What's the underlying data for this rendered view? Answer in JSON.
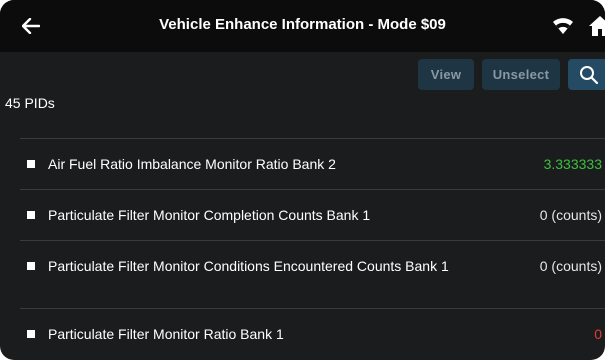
{
  "header": {
    "title": "Vehicle Enhance Information - Mode $09"
  },
  "toolbar": {
    "view_label": "View",
    "unselect_label": "Unselect"
  },
  "pid_count": "45 PIDs",
  "rows": [
    {
      "label": "Air Fuel Ratio Imbalance Monitor Ratio Bank 2",
      "value": "3.333333",
      "value_color": "#3fbf3f"
    },
    {
      "label": "Particulate Filter Monitor Completion Counts Bank 1",
      "value": "0 (counts)",
      "value_color": "#e6e6e6"
    },
    {
      "label": "Particulate Filter Monitor Conditions Encountered Counts Bank 1",
      "value": "0 (counts)",
      "value_color": "#e6e6e6"
    },
    {
      "label": "Particulate Filter Monitor Ratio Bank 1",
      "value": "0",
      "value_color": "#e03a3a"
    }
  ],
  "icons": {
    "back": "arrow-left-icon",
    "wifi": "wifi-icon",
    "home": "home-icon",
    "search": "search-icon"
  }
}
